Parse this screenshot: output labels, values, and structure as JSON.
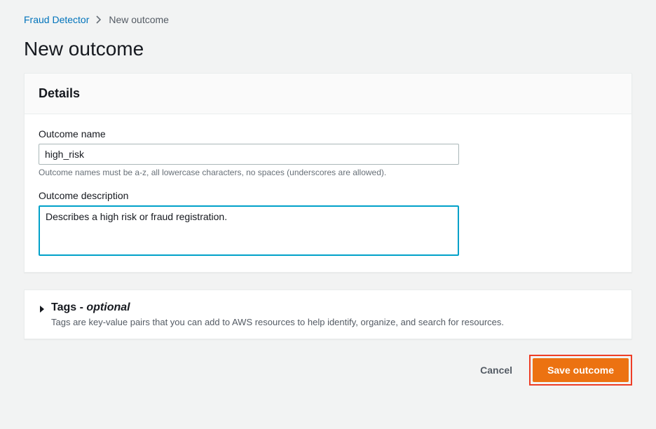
{
  "breadcrumb": {
    "root": "Fraud Detector",
    "current": "New outcome"
  },
  "page": {
    "title": "New outcome"
  },
  "details": {
    "heading": "Details",
    "name_label": "Outcome name",
    "name_value": "high_risk",
    "name_hint": "Outcome names must be a-z, all lowercase characters, no spaces (underscores are allowed).",
    "desc_label": "Outcome description",
    "desc_value": "Describes a high risk or fraud registration."
  },
  "tags": {
    "heading_main": "Tags",
    "heading_dash": " - ",
    "heading_optional": "optional",
    "description": "Tags are key-value pairs that you can add to AWS resources to help identify, organize, and search for resources."
  },
  "actions": {
    "cancel": "Cancel",
    "save": "Save outcome"
  }
}
